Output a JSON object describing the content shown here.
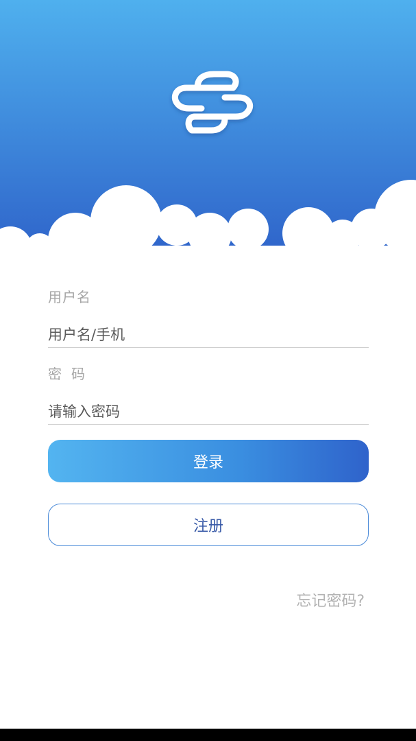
{
  "login": {
    "username_label": "用户名",
    "username_placeholder": "用户名/手机",
    "password_label": "密码",
    "password_placeholder": "请输入密码",
    "login_button": "登录",
    "register_button": "注册",
    "forgot_password": "忘记密码?"
  },
  "colors": {
    "header_top": "#4FB0EE",
    "header_bottom": "#2E62C9",
    "accent": "#3A8EE0"
  }
}
